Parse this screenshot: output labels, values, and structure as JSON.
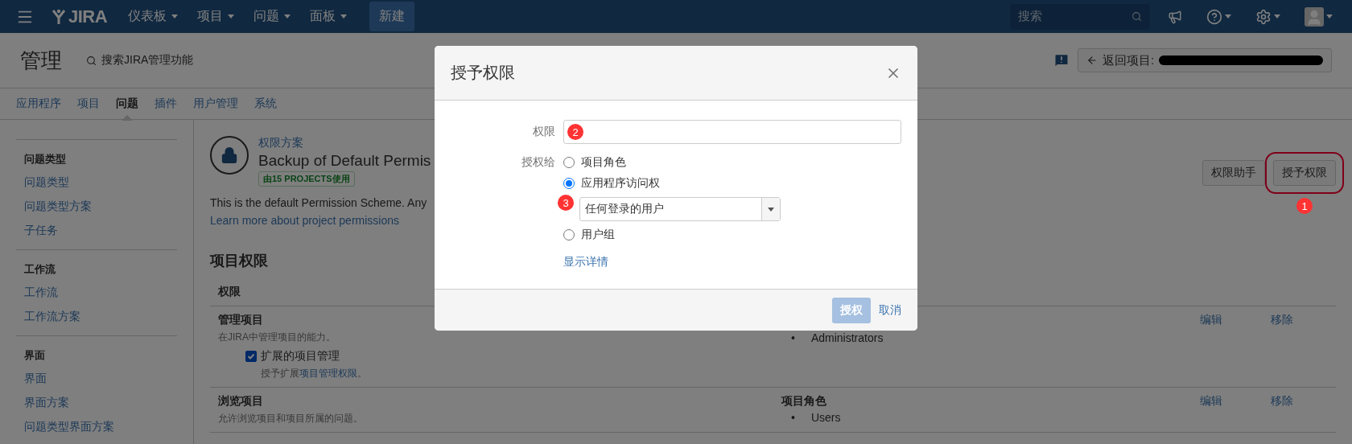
{
  "top_nav": {
    "logo": "JIRA",
    "menu_items": [
      {
        "label": "仪表板"
      },
      {
        "label": "项目"
      },
      {
        "label": "问题"
      },
      {
        "label": "面板"
      }
    ],
    "create_button": "新建",
    "search": {
      "placeholder": "搜索"
    }
  },
  "admin_header": {
    "title": "管理",
    "search_link": "搜索JIRA管理功能",
    "back_button": "返回项目:"
  },
  "admin_tabs": [
    {
      "label": "应用程序",
      "selected": false
    },
    {
      "label": "项目",
      "selected": false
    },
    {
      "label": "问题",
      "selected": true
    },
    {
      "label": "插件",
      "selected": false
    },
    {
      "label": "用户管理",
      "selected": false
    },
    {
      "label": "系统",
      "selected": false
    }
  ],
  "sidebar": {
    "sections": [
      {
        "heading": "问题类型",
        "items": [
          "问题类型",
          "问题类型方案",
          "子任务"
        ]
      },
      {
        "heading": "工作流",
        "items": [
          "工作流",
          "工作流方案"
        ]
      },
      {
        "heading": "界面",
        "items": [
          "界面",
          "界面方案",
          "问题类型界面方案"
        ]
      }
    ]
  },
  "scheme": {
    "kicker": "权限方案",
    "title": "Backup of Default Permis",
    "usage_badge": "由15 PROJECTS使用",
    "description": "This is the default Permission Scheme. Any",
    "learn_more": "Learn more about project permissions"
  },
  "actions": [
    {
      "label": "权限助手",
      "highlighted": false
    },
    {
      "label": "授予权限",
      "highlighted": true,
      "annotation": "1"
    }
  ],
  "permissions": {
    "heading": "项目权限",
    "column_1": "权限",
    "rows": [
      {
        "title": "管理项目",
        "description": "在JIRA中管理项目的能力。",
        "sub_permission": {
          "label": "扩展的项目管理",
          "checked": true,
          "description": "授予扩展",
          "link": "项目管理权限",
          "suffix": "。"
        },
        "grantees": [
          {
            "marker": "•",
            "name": "Administrators"
          }
        ],
        "edit": "编辑",
        "remove": "移除"
      },
      {
        "title": "浏览项目",
        "description": "允许浏览项目和项目所属的问题。",
        "grant_type": "项目角色",
        "grantees": [
          {
            "marker": "•",
            "name": "Users"
          }
        ],
        "edit": "编辑",
        "remove": "移除"
      }
    ]
  },
  "dialog": {
    "title": "授予权限",
    "permission": {
      "label": "权限",
      "annotation": "2"
    },
    "grant_to": {
      "label": "授权给",
      "options": [
        {
          "label": "项目角色",
          "selected": false
        },
        {
          "label": "应用程序访问权",
          "selected": true
        },
        {
          "label": "用户组",
          "selected": false
        }
      ],
      "select": {
        "value": "任何登录的用户",
        "annotation": "3"
      }
    },
    "show_details": "显示详情",
    "submit": {
      "label": "授权",
      "disabled": true
    },
    "cancel": "取消"
  }
}
